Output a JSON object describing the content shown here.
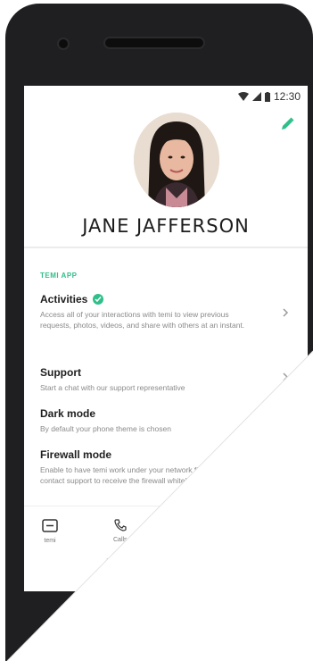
{
  "status_bar": {
    "time": "12:30",
    "icons": [
      "signal-icon",
      "wifi-icon",
      "battery-icon"
    ]
  },
  "profile": {
    "name": "JANE JAFFERSON",
    "edit_icon": "pencil-icon"
  },
  "section": {
    "label": "TEMI APP"
  },
  "menu": {
    "activities": {
      "title": "Activities",
      "desc": "Access all of your interactions with temi to view previous requests, photos, videos, and share with others at an instant."
    },
    "support": {
      "title": "Support",
      "desc": "Start a chat with our support representative"
    },
    "dark_mode": {
      "title": "Dark mode",
      "desc": "By default your phone theme is chosen"
    },
    "firewall": {
      "title": "Firewall mode",
      "desc": "Enable to have temi work under your network firewall. Please contact support to receive the firewall whitelist."
    }
  },
  "bottom_nav": {
    "temi_label": "temi",
    "calls_label": "Calls"
  },
  "colors": {
    "accent": "#2fbf8a",
    "phone_body": "#1f1f21"
  }
}
